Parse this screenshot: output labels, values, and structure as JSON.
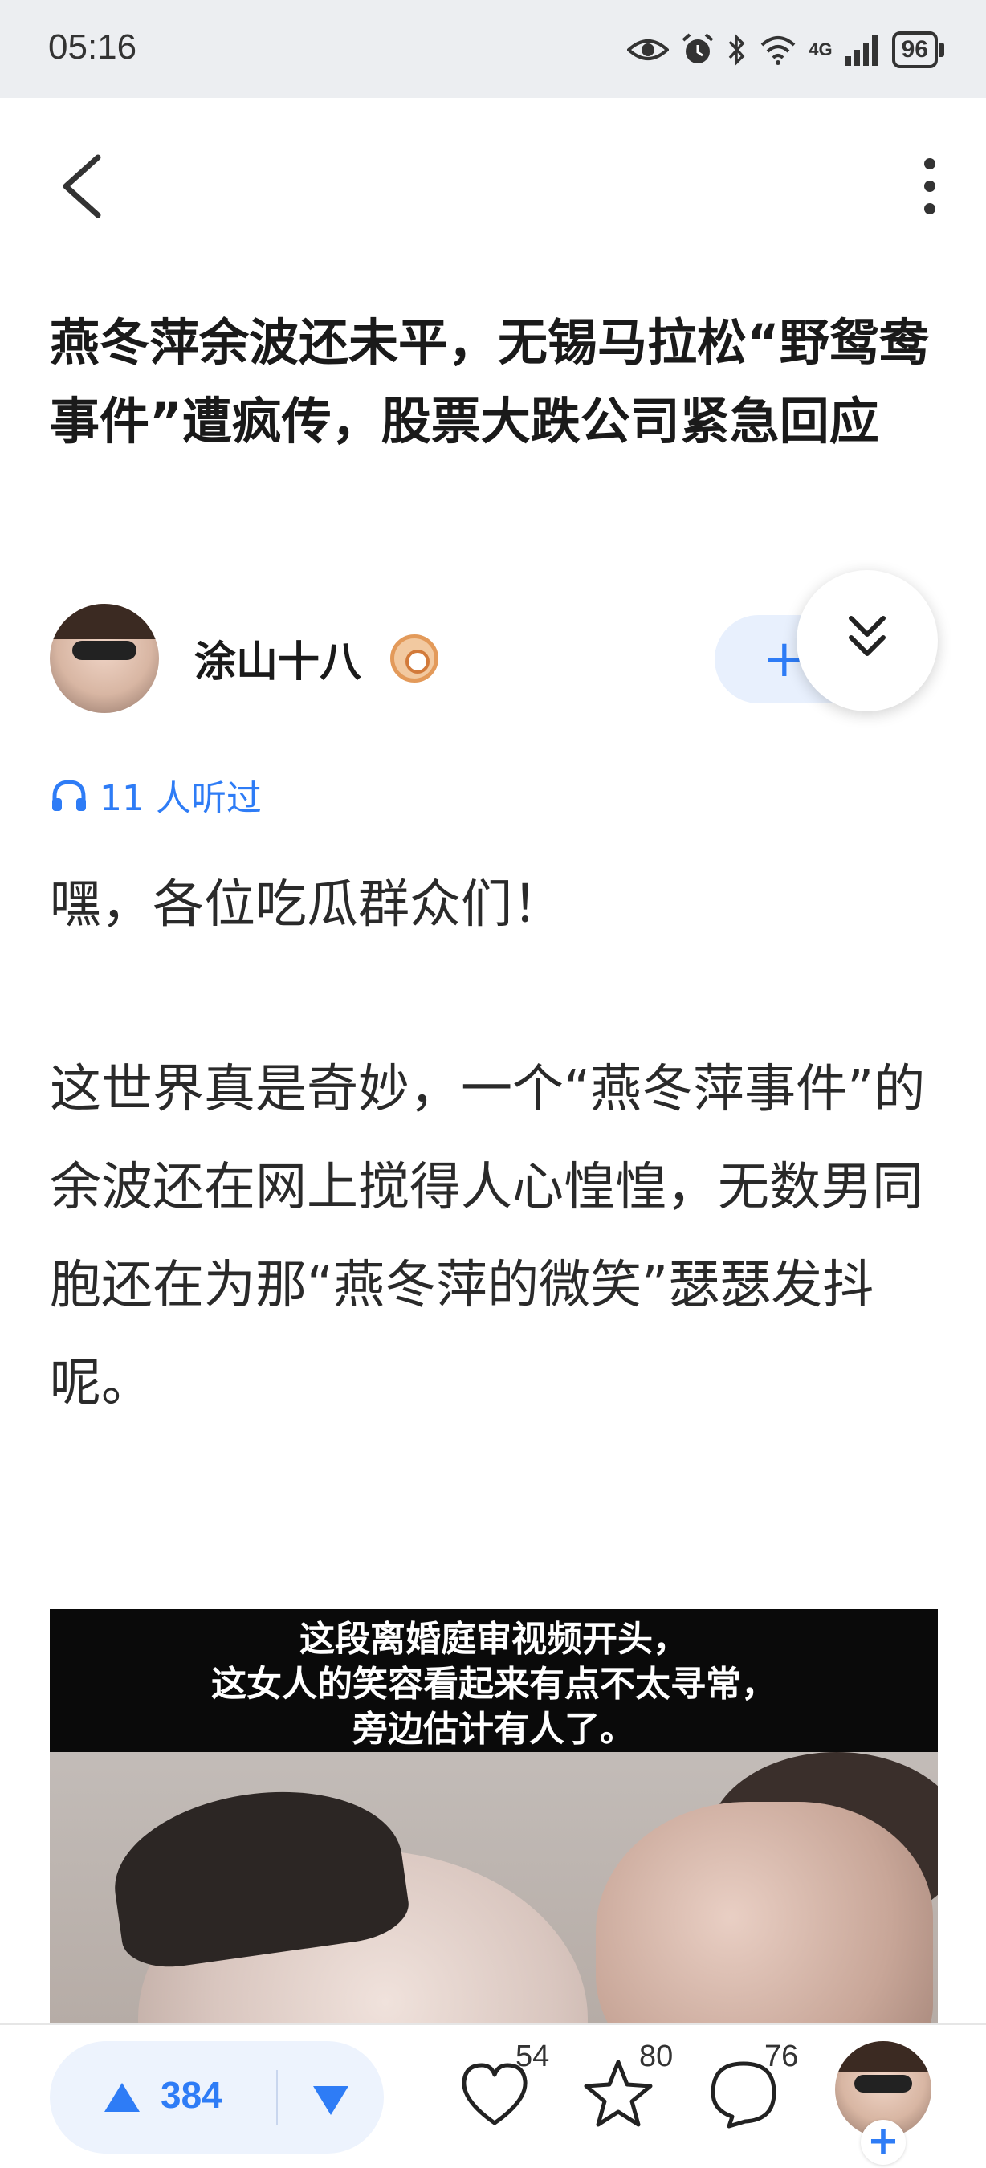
{
  "status_bar": {
    "time": "05:16",
    "network": "4G",
    "battery": "96",
    "icons": [
      "eye-icon",
      "alarm-icon",
      "bluetooth-icon",
      "wifi-icon",
      "signal-icon"
    ]
  },
  "nav": {
    "back_icon": "chevron-left-icon",
    "more_icon": "more-vertical-icon"
  },
  "article": {
    "title": "燕冬萍余波还未平，无锡马拉松“野鸳鸯事件”遭疯传，股票大跌公司紧急回应",
    "author": {
      "name": "涂山十八",
      "follow_label": "+"
    },
    "listen_count": "11 人听过",
    "paragraphs": [
      "嘿，各位吃瓜群众们！",
      "这世界真是奇妙，一个“燕冬萍事件”的余波还在网上搅得人心惶惶，无数男同胞还在为那“燕冬萍的微笑”瑟瑟发抖呢。"
    ],
    "image": {
      "caption_lines": [
        "这段离婚庭审视频开头，",
        "这女人的笑容看起来有点不太寻常，",
        "旁边估计有人了。"
      ]
    }
  },
  "bottom_bar": {
    "vote_count": "384",
    "like_count": "54",
    "favorite_count": "80",
    "comment_count": "76",
    "avatar_plus": "+"
  },
  "colors": {
    "accent": "#2e7cf6",
    "status_bg": "#eceef1"
  }
}
